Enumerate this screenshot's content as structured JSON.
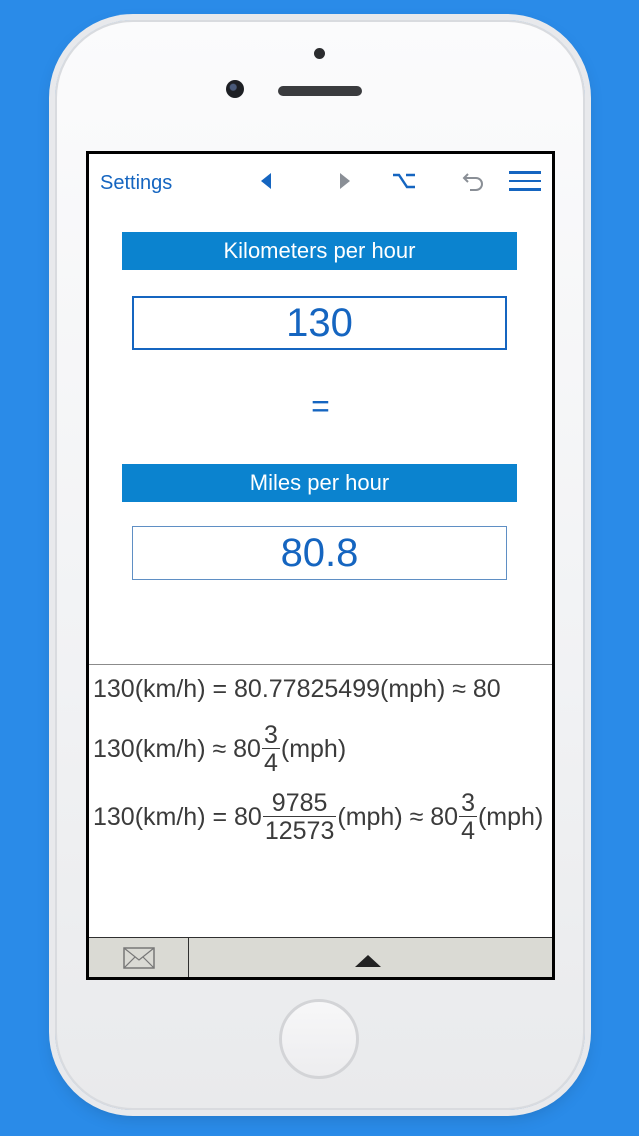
{
  "toolbar": {
    "settings_label": "Settings",
    "icons": [
      "prev-triangle-icon",
      "next-triangle-icon",
      "option-key-icon",
      "undo-icon",
      "menu-icon"
    ]
  },
  "converter": {
    "from_unit": "Kilometers per hour",
    "from_value": "130",
    "equals": "=",
    "to_unit": "Miles per hour",
    "to_value": "80.8"
  },
  "results": {
    "line1": {
      "lhs": "130(km/h) = 80.77825499(mph) ≈ 80"
    },
    "line2": {
      "lhs": "130(km/h) ≈ 80",
      "frac_num": "3",
      "frac_den": "4",
      "rhs": "(mph)"
    },
    "line3": {
      "lhs": "130(km/h) = 80",
      "frac_num": "9785",
      "frac_den": "12573",
      "mid": "(mph) ≈ 80",
      "frac2_num": "3",
      "frac2_den": "4",
      "rhs": "(mph)"
    }
  },
  "bottom_bar": {
    "icons": [
      "mail-icon",
      "expand-up-icon"
    ]
  },
  "colors": {
    "background": "#2a8be8",
    "accent_blue": "#1565c0",
    "header_blue": "#0b83cf",
    "bottom_bar": "#dadad4"
  }
}
